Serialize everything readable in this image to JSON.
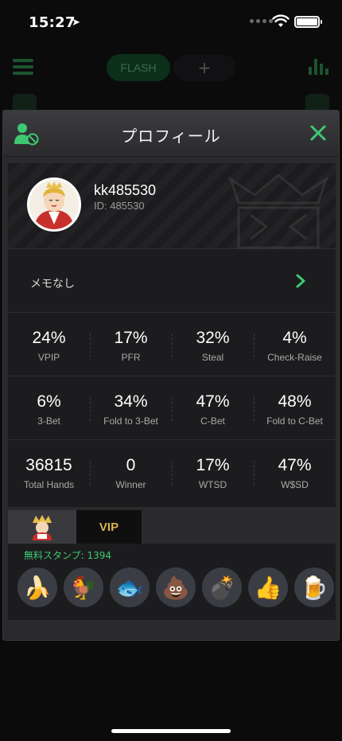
{
  "status_bar": {
    "time": "15:27"
  },
  "background": {
    "flash_tab": "FLASH",
    "plus_tab": "+"
  },
  "modal": {
    "title": "プロフィール",
    "user": {
      "name": "kk485530",
      "id": "ID: 485530"
    },
    "memo": "メモなし",
    "stats_rows": [
      [
        {
          "value": "24%",
          "label": "VPIP"
        },
        {
          "value": "17%",
          "label": "PFR"
        },
        {
          "value": "32%",
          "label": "Steal"
        },
        {
          "value": "4%",
          "label": "Check-Raise"
        }
      ],
      [
        {
          "value": "6%",
          "label": "3-Bet"
        },
        {
          "value": "34%",
          "label": "Fold to 3-Bet"
        },
        {
          "value": "47%",
          "label": "C-Bet"
        },
        {
          "value": "48%",
          "label": "Fold to C-Bet"
        }
      ],
      [
        {
          "value": "36815",
          "label": "Total Hands"
        },
        {
          "value": "0",
          "label": "Winner"
        },
        {
          "value": "17%",
          "label": "WTSD"
        },
        {
          "value": "47%",
          "label": "W$SD"
        }
      ]
    ],
    "stamps": {
      "vip_tab": "VIP",
      "free_count": "無料スタンプ: 1394",
      "items": [
        "banana-stamp",
        "rooster-stamp",
        "fish-stamp",
        "poop-stamp",
        "bomb-stamp",
        "thumbs-up-stamp",
        "beer-stamp"
      ]
    }
  },
  "colors": {
    "accent_green": "#3ec971",
    "vip_gold": "#d9b44a"
  }
}
